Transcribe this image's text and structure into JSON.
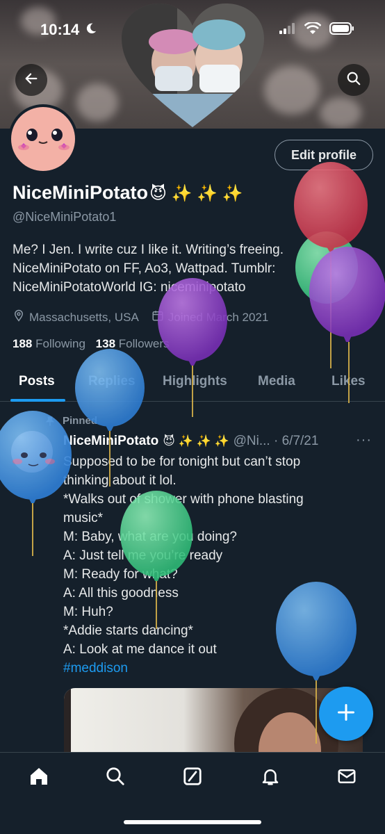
{
  "status_bar": {
    "time": "10:14"
  },
  "header": {
    "back_icon": "arrow-left-icon",
    "search_icon": "search-icon"
  },
  "profile": {
    "edit_label": "Edit profile",
    "display_name": "NiceMiniPotato",
    "name_emoji": "😈 ✨ ✨ ✨",
    "handle": "@NiceMiniPotato1",
    "bio_lines": [
      "Me? I Jen. I write cuz I like it. Writing’s freeing.",
      "NiceMiniPotato on FF, Ao3, Wattpad. Tumblr:",
      "NiceMiniPotatoWorld IG: niceminipotato"
    ],
    "location": "Massachusetts, USA",
    "joined": "Joined March 2021",
    "following_count": "188",
    "following_label": "Following",
    "followers_count": "138",
    "followers_label": "Followers"
  },
  "tabs": [
    "Posts",
    "Replies",
    "Highlights",
    "Media",
    "Likes"
  ],
  "tweet": {
    "pinned_label": "Pinned",
    "name": "NiceMiniPotato",
    "name_emoji": "😈 ✨ ✨ ✨",
    "handle_date": "@Ni... · 6/7/21",
    "more": "···",
    "lines": [
      "Supposed to be for tonight but can’t stop",
      "thinking about it lol.",
      "*Walks out of shower with phone blasting",
      "music*",
      "M: Baby, what are you doing?",
      "A: Just tell me you’re ready",
      "M: Ready for what?",
      "A: All this goodness",
      "M: Huh?",
      "*Addie starts dancing*",
      "A: Look at me dance it out"
    ],
    "hashtag": "#meddison"
  },
  "fab_icon": "plus-icon",
  "bottom_nav": [
    "home-icon",
    "search-icon",
    "compose-icon",
    "bell-icon",
    "mail-icon"
  ],
  "colors": {
    "accent": "#1d9bf0",
    "background": "#15202b",
    "muted": "#8b98a5"
  }
}
